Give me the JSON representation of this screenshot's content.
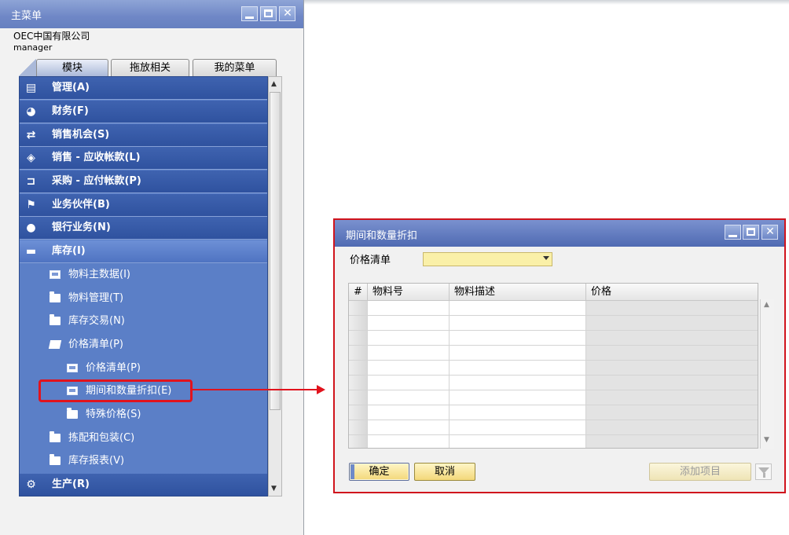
{
  "main_menu": {
    "title": "主菜单",
    "company": "OEC中国有限公司",
    "user": "manager",
    "tabs": [
      {
        "label": "模块"
      },
      {
        "label": "拖放相关"
      },
      {
        "label": "我的菜单"
      }
    ],
    "items": [
      {
        "label": "管理(A)",
        "icon": "document-icon"
      },
      {
        "label": "财务(F)",
        "icon": "finance-icon"
      },
      {
        "label": "销售机会(S)",
        "icon": "opportunity-icon"
      },
      {
        "label": "销售 - 应收帐款(L)",
        "icon": "tag-icon"
      },
      {
        "label": "采购 - 应付帐款(P)",
        "icon": "cart-icon"
      },
      {
        "label": "业务伙伴(B)",
        "icon": "partner-icon"
      },
      {
        "label": "银行业务(N)",
        "icon": "coins-icon"
      },
      {
        "label": "库存(I)",
        "icon": "box-icon"
      },
      {
        "label": "生产(R)",
        "icon": "gear-icon"
      }
    ],
    "inventory_sub": [
      {
        "label": "物料主数据(I)",
        "icon": "form-icon"
      },
      {
        "label": "物料管理(T)",
        "icon": "folder-icon"
      },
      {
        "label": "库存交易(N)",
        "icon": "folder-icon"
      },
      {
        "label": "价格清单(P)",
        "icon": "folder-open-icon"
      },
      {
        "label": "价格清单(P)",
        "icon": "form-icon"
      },
      {
        "label": "期间和数量折扣(E)",
        "icon": "form-icon"
      },
      {
        "label": "特殊价格(S)",
        "icon": "folder-icon"
      },
      {
        "label": "拣配和包装(C)",
        "icon": "folder-icon"
      },
      {
        "label": "库存报表(V)",
        "icon": "folder-icon"
      }
    ]
  },
  "dialog": {
    "title": "期间和数量折扣",
    "price_list_label": "价格清单",
    "price_list_value": "",
    "columns": [
      "#",
      "物料号",
      "物料描述",
      "价格"
    ],
    "row_count": 10,
    "ok_label": "确定",
    "cancel_label": "取消",
    "add_item_label": "添加项目"
  },
  "colors": {
    "menu_blue": "#2f529f",
    "highlight_red": "#e1131d",
    "select_yellow": "#faf0a8",
    "button_yellow": "#f3d87a"
  }
}
